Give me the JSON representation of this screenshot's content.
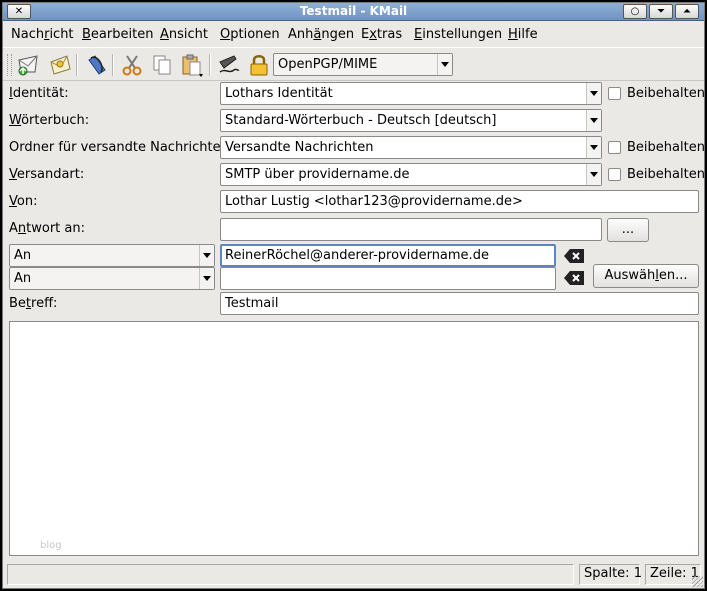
{
  "window": {
    "title": "Testmail - KMail",
    "close_glyph": "✕",
    "sticky_glyph": "○",
    "minimize_glyph": "⏷",
    "maximize_glyph": "⏶"
  },
  "menu": [
    {
      "label": "Nachricht",
      "pre": "Nach",
      "ul": "r",
      "post": "icht"
    },
    {
      "label": "Bearbeiten",
      "pre": "",
      "ul": "B",
      "post": "earbeiten"
    },
    {
      "label": "Ansicht",
      "pre": "",
      "ul": "A",
      "post": "nsicht"
    },
    {
      "label": "Optionen",
      "pre": "",
      "ul": "O",
      "post": "ptionen"
    },
    {
      "label": "Anhängen",
      "pre": "Anh",
      "ul": "ä",
      "post": "ngen"
    },
    {
      "label": "Extras",
      "pre": "E",
      "ul": "x",
      "post": "tras"
    },
    {
      "label": "Einstellungen",
      "pre": "",
      "ul": "E",
      "post": "instellungen"
    },
    {
      "label": "Hilfe",
      "pre": "",
      "ul": "H",
      "post": "ilfe"
    }
  ],
  "toolbar": {
    "icons": [
      "send-mail-icon",
      "queue-mail-icon",
      "attach-icon",
      "cut-icon",
      "copy-icon",
      "paste-icon",
      "sign-icon",
      "encrypt-lock-icon"
    ],
    "crypto_format": "OpenPGP/MIME"
  },
  "fields": {
    "identity": {
      "label_ul": "I",
      "label_rest": "dentität:",
      "value": "Lothars Identität",
      "keep_label": "Beibehalten"
    },
    "dictionary": {
      "label_ul": "W",
      "label_rest": "örterbuch:",
      "value": "Standard-Wörterbuch - Deutsch [deutsch]"
    },
    "sent_folder": {
      "label": "Ordner für versandte Nachrichten:",
      "value": "Versandte Nachrichten",
      "keep_label": "Beibehalten"
    },
    "transport": {
      "label_ul": "V",
      "label_rest": "ersandart:",
      "value": "SMTP über providername.de",
      "keep_label": "Beibehalten"
    },
    "from": {
      "label_ul": "V",
      "label_rest": "on:",
      "value": "Lothar Lustig <lothar123@providername.de>"
    },
    "reply_to": {
      "label_pre": "A",
      "label_ul": "n",
      "label_rest": "twort an:",
      "value": "",
      "browse_label": "..."
    },
    "recipients": [
      {
        "type": "An",
        "value": "ReinerRöchel@anderer-providername.de"
      },
      {
        "type": "An",
        "value": ""
      }
    ],
    "select_button": {
      "pre": "Auswäh",
      "ul": "l",
      "post": "en..."
    },
    "subject": {
      "label_pre": "Be",
      "label_ul": "t",
      "label_rest": "reff:",
      "value": "Testmail"
    }
  },
  "editor": {
    "watermark": "blog"
  },
  "status": {
    "message": "",
    "column": "Spalte: 1",
    "line": "Zeile: 1"
  }
}
